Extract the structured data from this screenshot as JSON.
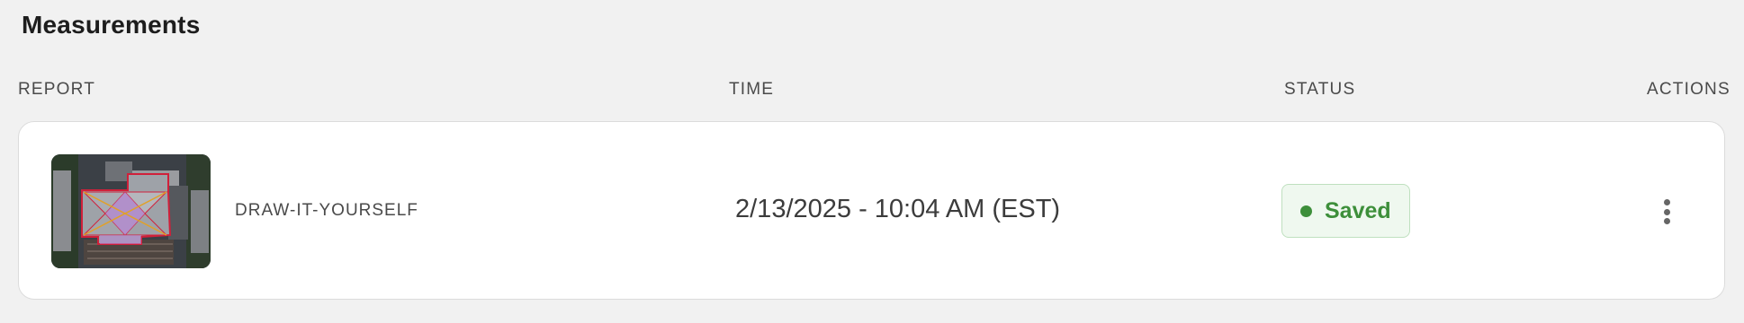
{
  "page": {
    "title": "Measurements"
  },
  "table": {
    "headers": {
      "report": "REPORT",
      "time": "TIME",
      "status": "STATUS",
      "actions": "ACTIONS"
    },
    "rows": [
      {
        "report_name": "DRAW-IT-YOURSELF",
        "time": "2/13/2025 - 10:04 AM (EST)",
        "status": "Saved",
        "actions_icon": "more-vertical-icon"
      }
    ]
  },
  "colors": {
    "status_saved": "#3d8f3a",
    "status_saved_bg": "#eff8ef",
    "roof_outline": "#d0203a",
    "roof_facet": "#b78ad6"
  }
}
